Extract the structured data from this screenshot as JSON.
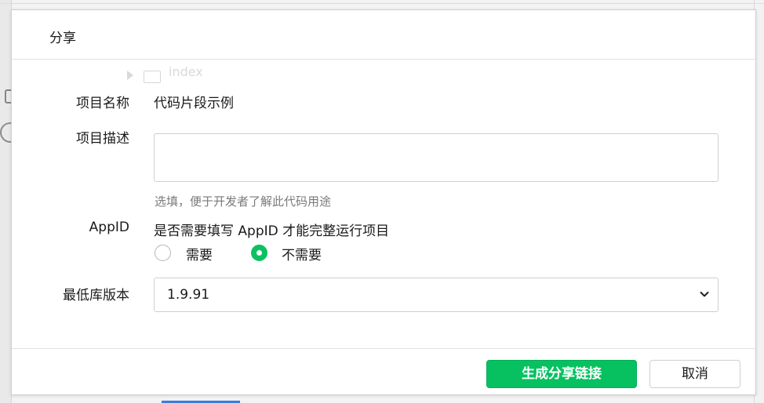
{
  "background": {
    "tree_item": "index"
  },
  "dialog": {
    "title": "分享",
    "project_name": {
      "label": "项目名称",
      "value": "代码片段示例"
    },
    "project_desc": {
      "label": "项目描述",
      "value": "",
      "hint": "选填，便于开发者了解此代码用途"
    },
    "appid": {
      "label": "AppID",
      "question": "是否需要填写 AppID 才能完整运行项目",
      "options": [
        "需要",
        "不需要"
      ],
      "selected": "不需要"
    },
    "min_lib_version": {
      "label": "最低库版本",
      "selected": "1.9.91"
    },
    "buttons": {
      "generate": "生成分享链接",
      "cancel": "取消"
    }
  },
  "colors": {
    "primary": "#07c160",
    "radio_selected": "#0bc160"
  }
}
